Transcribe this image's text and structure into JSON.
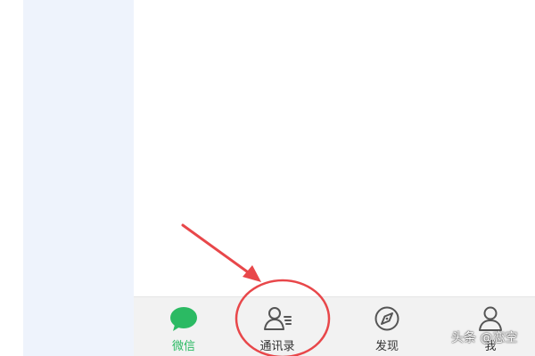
{
  "colors": {
    "left_panel": "#eef3fc",
    "tabbar_bg": "#f2f2f2",
    "active_green": "#2bba63",
    "icon_gray": "#555555",
    "annotation_red": "#e8474a"
  },
  "tabbar": {
    "tabs": [
      {
        "label": "微信",
        "icon": "chat-bubble-icon",
        "active": true
      },
      {
        "label": "通讯录",
        "icon": "contacts-icon",
        "active": false
      },
      {
        "label": "发现",
        "icon": "compass-icon",
        "active": false
      },
      {
        "label": "我",
        "icon": "person-icon",
        "active": false
      }
    ]
  },
  "watermark": {
    "text": "头条 @恋空"
  }
}
